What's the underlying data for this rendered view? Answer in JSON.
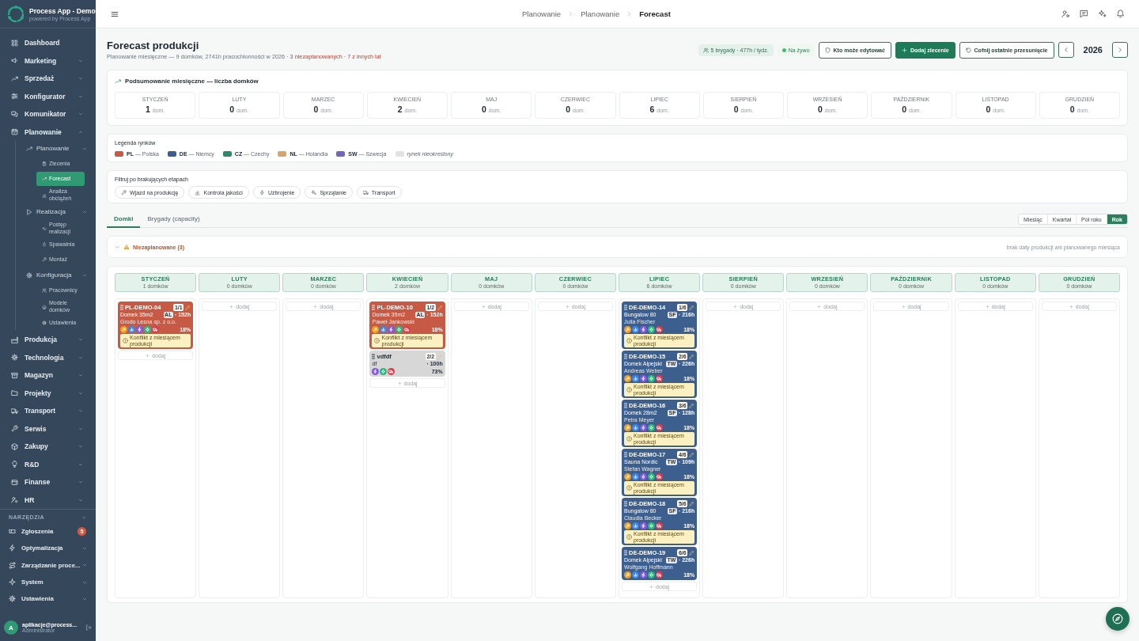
{
  "sidebar": {
    "brand": {
      "title": "Process App - Demo",
      "subtitle": "powered by Process App"
    },
    "items": [
      {
        "label": "Dashboard",
        "kind": "link",
        "selected": false
      },
      {
        "label": "Marketing",
        "kind": "group",
        "expanded": false
      },
      {
        "label": "Sprzedaż",
        "kind": "group",
        "expanded": false
      },
      {
        "label": "Konfigurator",
        "kind": "group",
        "expanded": false
      },
      {
        "label": "Komunikator",
        "kind": "group",
        "expanded": false
      },
      {
        "label": "Planowanie",
        "kind": "group",
        "expanded": true,
        "children": [
          {
            "label": "Planowanie",
            "kind": "group",
            "expanded": true,
            "children": [
              {
                "label": "Zlecenia",
                "kind": "link",
                "selected": false
              },
              {
                "label": "Forecast",
                "kind": "link",
                "selected": true
              },
              {
                "label": "Analiza obciążeń",
                "kind": "link",
                "selected": false
              }
            ]
          },
          {
            "label": "Realizacja",
            "kind": "group",
            "expanded": true,
            "children": [
              {
                "label": "Postęp realizacji",
                "kind": "link",
                "selected": false
              },
              {
                "label": "Spawalnia",
                "kind": "link",
                "selected": false
              },
              {
                "label": "Montaż",
                "kind": "link",
                "selected": false
              }
            ]
          },
          {
            "label": "Konfiguracja",
            "kind": "group",
            "expanded": true,
            "children": [
              {
                "label": "Pracownicy",
                "kind": "link",
                "selected": false
              },
              {
                "label": "Modele domków",
                "kind": "link",
                "selected": false
              },
              {
                "label": "Ustawienia",
                "kind": "link",
                "selected": false
              }
            ]
          }
        ]
      },
      {
        "label": "Produkcja",
        "kind": "group",
        "expanded": false
      },
      {
        "label": "Technologia",
        "kind": "group",
        "expanded": false
      },
      {
        "label": "Magazyn",
        "kind": "group",
        "expanded": false
      },
      {
        "label": "Projekty",
        "kind": "group",
        "expanded": false
      },
      {
        "label": "Transport",
        "kind": "group",
        "expanded": false
      },
      {
        "label": "Serwis",
        "kind": "group",
        "expanded": false
      },
      {
        "label": "Zakupy",
        "kind": "group",
        "expanded": false
      },
      {
        "label": "R&D",
        "kind": "group",
        "expanded": false
      },
      {
        "label": "Finanse",
        "kind": "group",
        "expanded": false
      },
      {
        "label": "HR",
        "kind": "group",
        "expanded": false
      }
    ],
    "tools_header": "NARZĘDZIA",
    "tools": [
      {
        "label": "Zgłoszenia",
        "kind": "link",
        "selected": false,
        "badge": "5"
      },
      {
        "label": "Optymalizacja",
        "kind": "group",
        "expanded": false
      },
      {
        "label": "Zarządzanie proce...",
        "kind": "group",
        "expanded": false
      },
      {
        "label": "System",
        "kind": "group",
        "expanded": false
      },
      {
        "label": "Ustawienia",
        "kind": "group",
        "expanded": false
      }
    ],
    "user": {
      "initial": "A",
      "name": "aplikacje@process...",
      "role": "Administrator"
    }
  },
  "topbar": {
    "breadcrumb": [
      "Planowanie",
      "Planowanie",
      "Forecast"
    ]
  },
  "page": {
    "title": "Forecast produkcji",
    "subtitle": [
      {
        "kind": "plain",
        "text": "Planowanie miesięczne — 9 domków, 2741h pracochłonności w 2026 · "
      },
      {
        "kind": "alert",
        "text": "3 niezaplanowanych"
      },
      {
        "kind": "plain",
        "text": " · "
      },
      {
        "kind": "alert",
        "text": "7 z innych lat"
      }
    ],
    "crews": "5 brygady · 477h / tydz.",
    "live": {
      "label": "Na żywo",
      "on": true
    },
    "actions": [
      {
        "label": "Kto może edytować",
        "kind": "outline"
      },
      {
        "label": "Dodaj zlecenie",
        "kind": "primary"
      },
      {
        "label": "Cofnij ostatnie przesunięcie",
        "kind": "outline"
      }
    ],
    "year": "2026"
  },
  "summary": {
    "title": "Podsumowanie miesięczne — liczba domków",
    "months": [
      {
        "label": "STYCZEŃ",
        "count": "1",
        "unit": "dom."
      },
      {
        "label": "LUTY",
        "count": "0",
        "unit": "dom."
      },
      {
        "label": "MARZEC",
        "count": "0",
        "unit": "dom."
      },
      {
        "label": "KWIECIEŃ",
        "count": "2",
        "unit": "dom."
      },
      {
        "label": "MAJ",
        "count": "0",
        "unit": "dom."
      },
      {
        "label": "CZERWIEC",
        "count": "0",
        "unit": "dom."
      },
      {
        "label": "LIPIEC",
        "count": "6",
        "unit": "dom."
      },
      {
        "label": "SIERPIEŃ",
        "count": "0",
        "unit": "dom."
      },
      {
        "label": "WRZESIEŃ",
        "count": "0",
        "unit": "dom."
      },
      {
        "label": "PAŹDZIERNIK",
        "count": "0",
        "unit": "dom."
      },
      {
        "label": "LISTOPAD",
        "count": "0",
        "unit": "dom."
      },
      {
        "label": "GRUDZIEŃ",
        "count": "0",
        "unit": "dom."
      }
    ]
  },
  "legend": {
    "title": "Legenda rynków",
    "items": [
      {
        "kind": "market",
        "label": "**PL** — Polska",
        "color": "#c65a44"
      },
      {
        "kind": "market",
        "label": "**DE** — Niemcy",
        "color": "#3d5f8e"
      },
      {
        "kind": "market",
        "label": "**CZ** — Czechy",
        "color": "#2e8a68"
      },
      {
        "kind": "market",
        "label": "**NL** — Holandia",
        "color": "#d9a46c"
      },
      {
        "kind": "market",
        "label": "**SW** — Szwecja",
        "color": "#7465b5"
      },
      {
        "kind": "unspecified",
        "label": "rynek nieokreślony",
        "color": "#e2e2e2"
      }
    ]
  },
  "filter": {
    "title": "Filtruj po brakujących etapach",
    "stages": [
      {
        "kind": "entry",
        "label": "Wjazd na produkcję",
        "selected": false
      },
      {
        "kind": "quality",
        "label": "Kontrola jakości",
        "selected": false
      },
      {
        "kind": "wiring",
        "label": "Uzbrojenie",
        "selected": false
      },
      {
        "kind": "cleaning",
        "label": "Sprzątanie",
        "selected": false
      },
      {
        "kind": "transport",
        "label": "Transport",
        "selected": false
      }
    ]
  },
  "view": {
    "tabs": [
      {
        "label": "Domki",
        "selected": true
      },
      {
        "label": "Brygady (capacity)",
        "selected": false
      }
    ],
    "ranges": [
      {
        "label": "Miesiąc",
        "selected": false
      },
      {
        "label": "Kwartał",
        "selected": false
      },
      {
        "label": "Pół roku",
        "selected": false
      },
      {
        "label": "Rok",
        "selected": true
      }
    ]
  },
  "unplanned": {
    "label": "Niezaplanowane (3)",
    "expanded": false,
    "hint": "brak daty produkcji ani planowanego miesiąca"
  },
  "board": {
    "columns": [
      {
        "month": "STYCZEŃ",
        "count": "1 domków",
        "add_label": "dodaj",
        "cards": [
          {
            "code": "PL-DEMO-04",
            "sequence": "1/1",
            "color": "#c65a44",
            "model": "Domek 35m2",
            "crew": "AL",
            "hours": "· 152h",
            "client": "Grodo Lesna sp. z o.o.",
            "stages": [
              {
                "kind": "entry"
              },
              {
                "kind": "quality"
              },
              {
                "kind": "wiring"
              },
              {
                "kind": "cleaning"
              },
              {
                "kind": "transport"
              }
            ],
            "progress": "18%",
            "conflict": "Konflikt z miesiącem produkcji"
          }
        ]
      },
      {
        "month": "LUTY",
        "count": "0 domków",
        "add_label": "dodaj"
      },
      {
        "month": "MARZEC",
        "count": "0 domków",
        "add_label": "dodaj"
      },
      {
        "month": "KWIECIEŃ",
        "count": "2 domków",
        "add_label": "dodaj",
        "cards": [
          {
            "code": "PL-DEMO-10",
            "sequence": "1/2",
            "color": "#c65a44",
            "model": "Domek 35m2",
            "crew": "AL",
            "hours": "· 152h",
            "client": "Paweł Jankowski",
            "stages": [
              {
                "kind": "entry"
              },
              {
                "kind": "quality"
              },
              {
                "kind": "wiring"
              },
              {
                "kind": "cleaning"
              },
              {
                "kind": "transport"
              }
            ],
            "progress": "18%",
            "conflict": "Konflikt z miesiącem produkcji"
          },
          {
            "code": "vdfdf",
            "sequence": "2/2",
            "color": "#d7d7d7",
            "model": "df",
            "hours": "· 100h",
            "stages": [
              {
                "kind": "wiring"
              },
              {
                "kind": "cleaning"
              },
              {
                "kind": "transport"
              }
            ],
            "progress": "73%"
          }
        ]
      },
      {
        "month": "MAJ",
        "count": "0 domków",
        "add_label": "dodaj"
      },
      {
        "month": "CZERWIEC",
        "count": "0 domków",
        "add_label": "dodaj"
      },
      {
        "month": "LIPIEC",
        "count": "6 domków",
        "add_label": "dodaj",
        "cards": [
          {
            "code": "DE-DEMO-14",
            "sequence": "1/6",
            "color": "#3d5f8e",
            "model": "Bungalow 80",
            "crew": "SF",
            "hours": "· 216h",
            "client": "Julia Fischer",
            "stages": [
              {
                "kind": "entry"
              },
              {
                "kind": "quality"
              },
              {
                "kind": "wiring"
              },
              {
                "kind": "cleaning"
              },
              {
                "kind": "transport"
              }
            ],
            "progress": "18%",
            "conflict": "Konflikt z miesiącem produkcji"
          },
          {
            "code": "DE-DEMO-15",
            "sequence": "2/6",
            "color": "#3d5f8e",
            "model": "Domek Alpejski",
            "crew": "TW",
            "hours": "· 226h",
            "client": "Andreas Weber",
            "stages": [
              {
                "kind": "entry"
              },
              {
                "kind": "quality"
              },
              {
                "kind": "wiring"
              },
              {
                "kind": "cleaning"
              },
              {
                "kind": "transport"
              }
            ],
            "progress": "18%",
            "conflict": "Konflikt z miesiącem produkcji"
          },
          {
            "code": "DE-DEMO-16",
            "sequence": "3/6",
            "color": "#3d5f8e",
            "model": "Domek 28m2",
            "crew": "SF",
            "hours": "· 128h",
            "client": "Petra Meyer",
            "stages": [
              {
                "kind": "entry"
              },
              {
                "kind": "quality"
              },
              {
                "kind": "wiring"
              },
              {
                "kind": "cleaning"
              },
              {
                "kind": "transport"
              }
            ],
            "progress": "18%",
            "conflict": "Konflikt z miesiącem produkcji"
          },
          {
            "code": "DE-DEMO-17",
            "sequence": "4/6",
            "color": "#3d5f8e",
            "model": "Sauna Nordic",
            "crew": "TW",
            "hours": "· 109h",
            "client": "Stefan Wagner",
            "stages": [
              {
                "kind": "entry"
              },
              {
                "kind": "quality"
              },
              {
                "kind": "wiring"
              },
              {
                "kind": "cleaning"
              },
              {
                "kind": "transport"
              }
            ],
            "progress": "18%",
            "conflict": "Konflikt z miesiącem produkcji"
          },
          {
            "code": "DE-DEMO-18",
            "sequence": "5/6",
            "color": "#3d5f8e",
            "model": "Bungalow 80",
            "crew": "SF",
            "hours": "· 216h",
            "client": "Claudia Becker",
            "stages": [
              {
                "kind": "entry"
              },
              {
                "kind": "quality"
              },
              {
                "kind": "wiring"
              },
              {
                "kind": "cleaning"
              },
              {
                "kind": "transport"
              }
            ],
            "progress": "18%",
            "conflict": "Konflikt z miesiącem produkcji"
          },
          {
            "code": "DE-DEMO-19",
            "sequence": "6/6",
            "color": "#3d5f8e",
            "model": "Domek Alpejski",
            "crew": "TW",
            "hours": "· 226h",
            "client": "Wolfgang Hoffmann",
            "stages": [
              {
                "kind": "entry"
              },
              {
                "kind": "quality"
              },
              {
                "kind": "wiring"
              },
              {
                "kind": "cleaning"
              },
              {
                "kind": "transport"
              }
            ],
            "progress": "18%"
          }
        ]
      },
      {
        "month": "SIERPIEŃ",
        "count": "0 domków",
        "add_label": "dodaj"
      },
      {
        "month": "WRZESIEŃ",
        "count": "0 domków",
        "add_label": "dodaj"
      },
      {
        "month": "PAŹDZIERNIK",
        "count": "0 domków",
        "add_label": "dodaj"
      },
      {
        "month": "LISTOPAD",
        "count": "0 domków",
        "add_label": "dodaj"
      },
      {
        "month": "GRUDZIEŃ",
        "count": "0 domków",
        "add_label": "dodaj"
      }
    ]
  }
}
